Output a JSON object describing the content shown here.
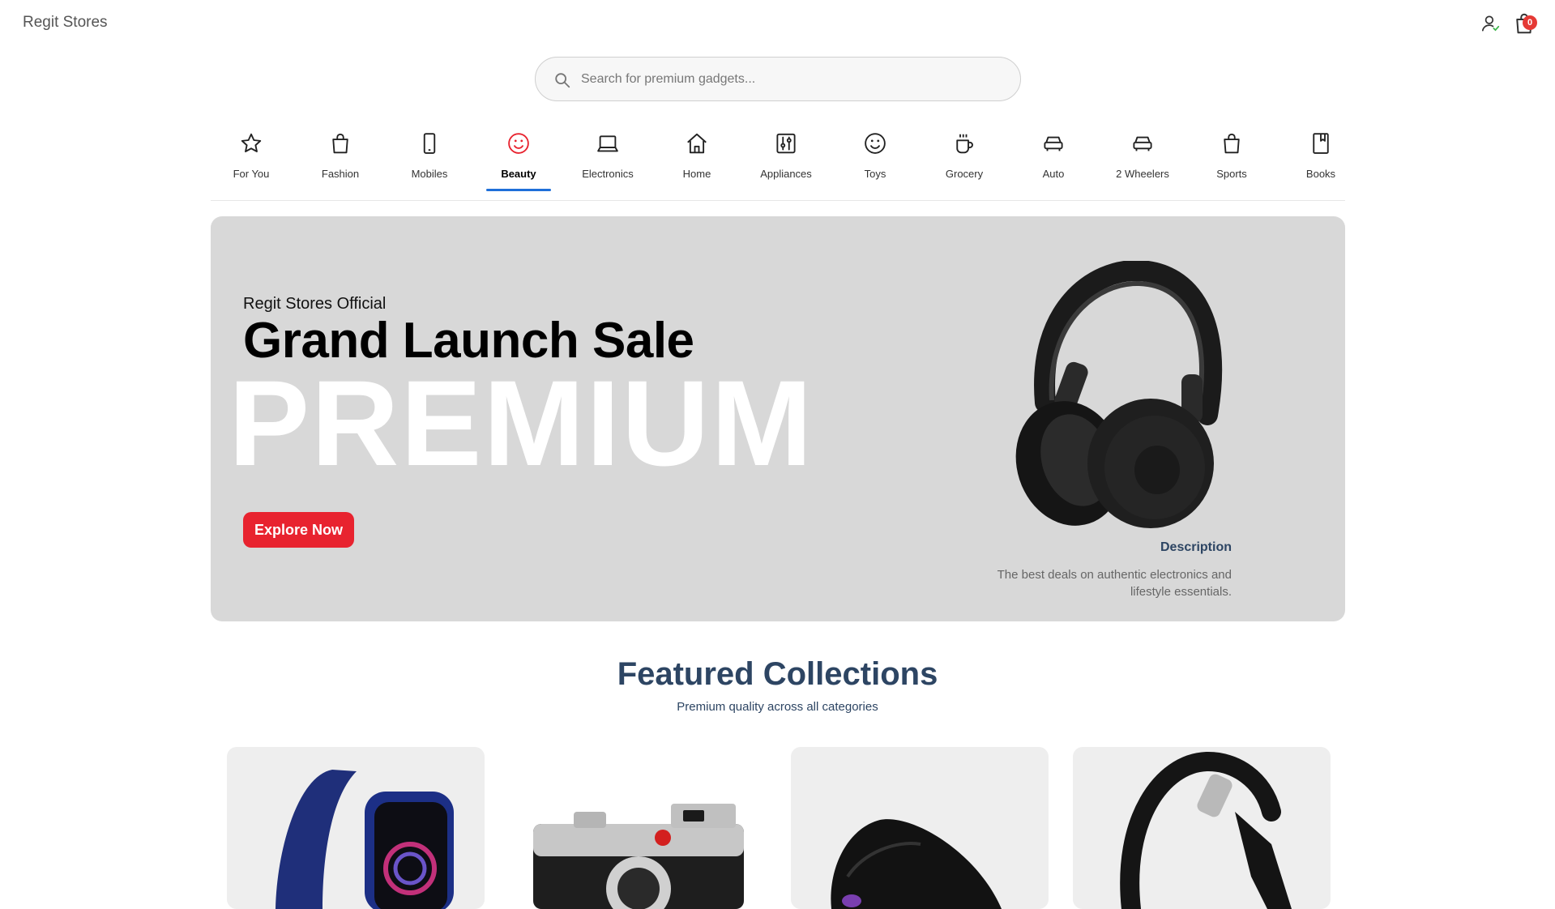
{
  "header": {
    "brand": "Regit Stores",
    "user_icon": "user-icon",
    "cart_icon": "shopping-bag-icon",
    "cart_count": "0"
  },
  "search": {
    "placeholder": "Search for premium gadgets...",
    "value": ""
  },
  "categories": [
    {
      "label": "For You",
      "icon": "star-icon"
    },
    {
      "label": "Fashion",
      "icon": "shopping-bag-icon"
    },
    {
      "label": "Mobiles",
      "icon": "phone-icon"
    },
    {
      "label": "Beauty",
      "icon": "smile-icon",
      "active": true
    },
    {
      "label": "Electronics",
      "icon": "laptop-icon"
    },
    {
      "label": "Home",
      "icon": "home-icon"
    },
    {
      "label": "Appliances",
      "icon": "sliders-icon"
    },
    {
      "label": "Toys",
      "icon": "smile-icon"
    },
    {
      "label": "Grocery",
      "icon": "coffee-icon"
    },
    {
      "label": "Auto",
      "icon": "car-icon"
    },
    {
      "label": "2 Wheelers",
      "icon": "car-icon"
    },
    {
      "label": "Sports",
      "icon": "shopping-bag-icon"
    },
    {
      "label": "Books",
      "icon": "book-icon"
    }
  ],
  "hero": {
    "kicker": "Regit Stores Official",
    "title": "Grand Launch Sale",
    "big_text": "PREMIUM",
    "cta": "Explore Now",
    "image": "headphones-image",
    "description_title": "Description",
    "description": "The best deals on authentic electronics and lifestyle essentials."
  },
  "featured": {
    "title": "Featured Collections",
    "subtitle": "Premium quality across all categories",
    "cards": [
      {
        "image": "smartwatch-image"
      },
      {
        "image": "camera-image"
      },
      {
        "image": "earbuds-case-image"
      },
      {
        "image": "headphones-image"
      }
    ]
  },
  "colors": {
    "accent_red": "#e8232f",
    "active_tab": "#1e6fd9",
    "heading_navy": "#2d4563",
    "hero_bg": "#d8d8d8"
  }
}
